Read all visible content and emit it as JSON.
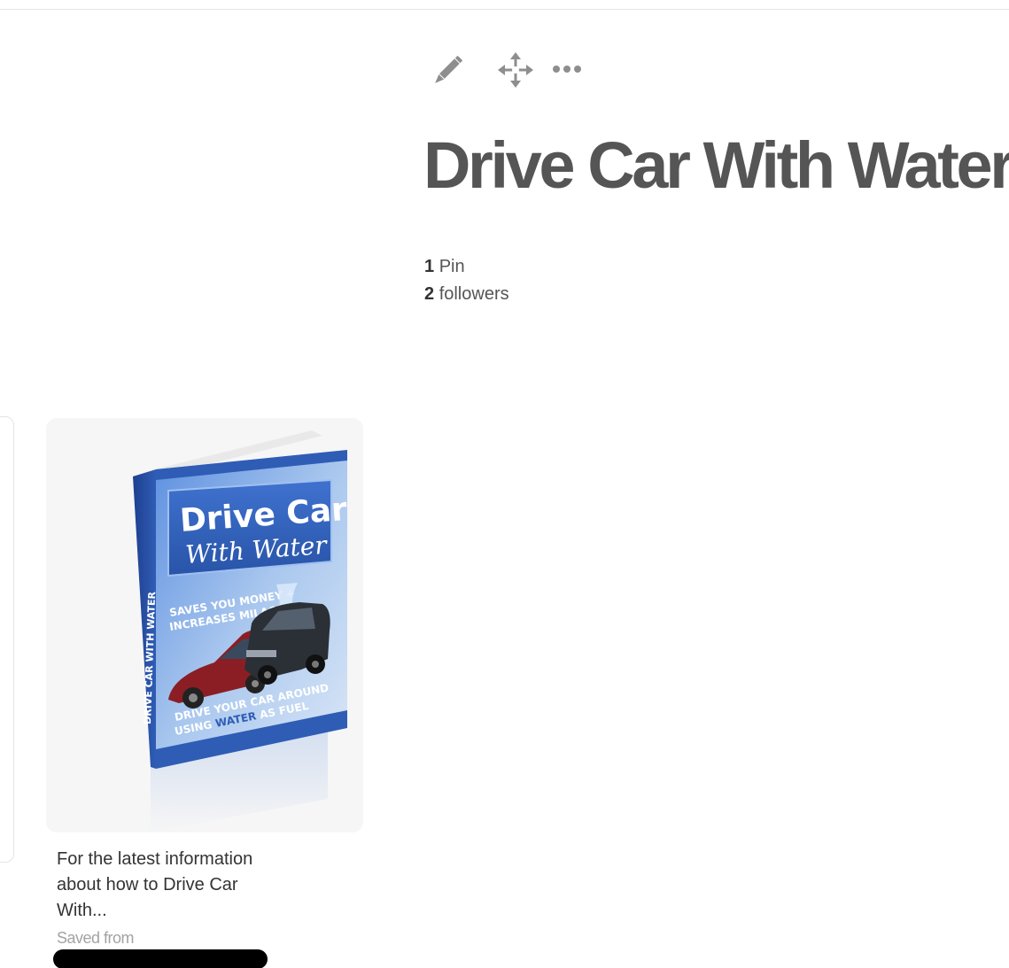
{
  "board": {
    "title": "Drive Car With Water",
    "actions": {
      "edit_icon": "pencil-icon",
      "move_icon": "move-arrows-icon",
      "more_icon": "more-dots-icon"
    },
    "stats": {
      "pins_count": "1",
      "pins_label": "Pin",
      "followers_count": "2",
      "followers_label": "followers"
    }
  },
  "pin": {
    "image": {
      "book_title_line1": "Drive Car",
      "book_title_line2": "With Water",
      "tagline_line1": "SAVES YOU MONEY +",
      "tagline_line2": "INCREASES MILAGE!",
      "bottom_line1": "DRIVE YOUR CAR AROUND",
      "bottom_line2_a": "USING ",
      "bottom_line2_b": "WATER",
      "bottom_line2_c": " AS FUEL",
      "spine": "DRIVE CAR WITH WATER"
    },
    "description": "For the latest information about how to Drive Car With...",
    "saved_from_label": "Saved from"
  },
  "colors": {
    "title": "#555555",
    "text": "#333333",
    "muted": "#a3a3a3",
    "icon": "#8e8e8e",
    "book_blue": "#2f5db5"
  }
}
